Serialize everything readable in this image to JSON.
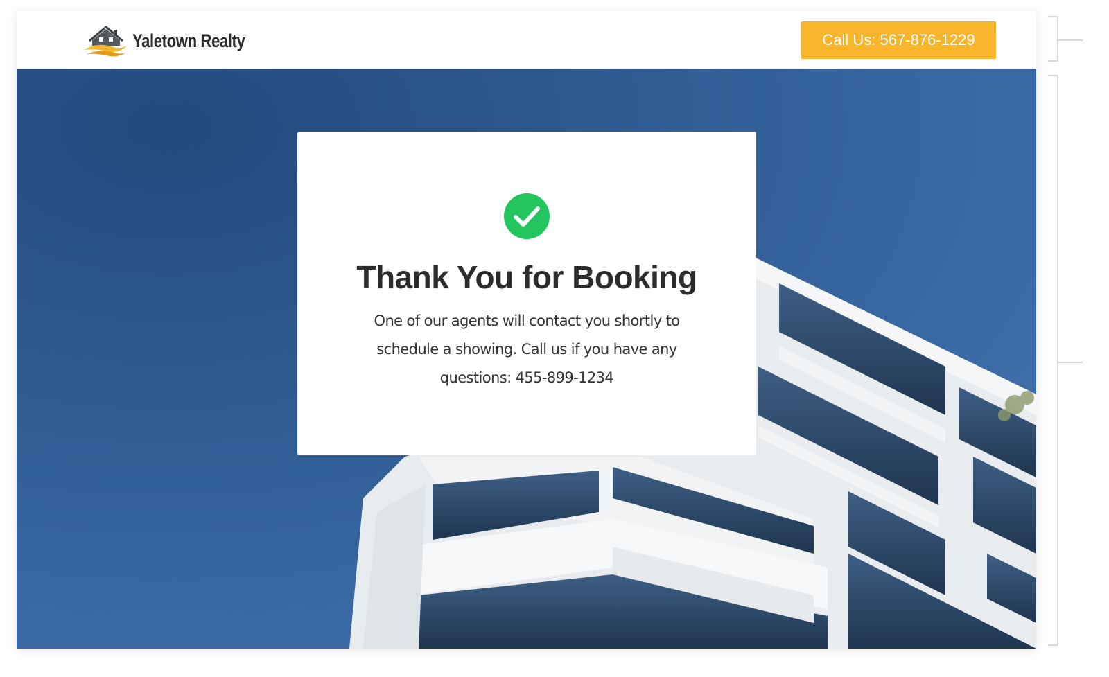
{
  "header": {
    "brand_name": "Yaletown Realty",
    "call_button_label": "Call Us: 567-876-1229"
  },
  "confirmation": {
    "icon": "check-circle-icon",
    "title": "Thank You for Booking",
    "message": "One of our agents will contact you shortly to schedule a showing. Call us if you have any questions: 455-899-1234"
  },
  "colors": {
    "accent": "#f6b52a",
    "success": "#22c55e",
    "hero_blue": "#2e5a90",
    "text": "#2c2c2c"
  }
}
